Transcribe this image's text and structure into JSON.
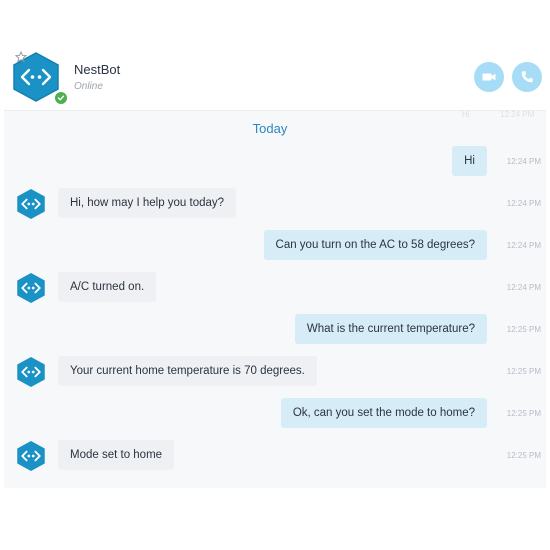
{
  "header": {
    "bot_name": "NestBot",
    "status": "Online",
    "avatar_icon": "chatbot-hexagon-icon",
    "favorite_icon": "star-outline-icon",
    "online_indicator_icon": "check-circle-icon",
    "video_call_icon": "video-camera-icon",
    "voice_call_icon": "phone-icon"
  },
  "day_separator": "Today",
  "messages": [
    {
      "sender": "user",
      "text": "Hi",
      "time": "12:24 PM"
    },
    {
      "sender": "bot",
      "text": "Hi, how may I help you today?",
      "time": "12:24 PM"
    },
    {
      "sender": "user",
      "text": "Can you turn on the AC to 58 degrees?",
      "time": "12:24 PM"
    },
    {
      "sender": "bot",
      "text": "A/C turned on.",
      "time": "12:24 PM"
    },
    {
      "sender": "user",
      "text": "What is the current temperature?",
      "time": "12:25 PM"
    },
    {
      "sender": "bot",
      "text": "Your current home temperature is 70 degrees.",
      "time": "12:25 PM"
    },
    {
      "sender": "user",
      "text": "Ok, can you set the mode to home?",
      "time": "12:25 PM"
    },
    {
      "sender": "bot",
      "text": "Mode set to home",
      "time": "12:25 PM"
    }
  ],
  "colors": {
    "accent": "#1a92c5",
    "user_bubble": "#d6edf8",
    "bot_bubble": "#eef0f3",
    "call_button": "#a6dcf5",
    "online": "#4caf50"
  }
}
